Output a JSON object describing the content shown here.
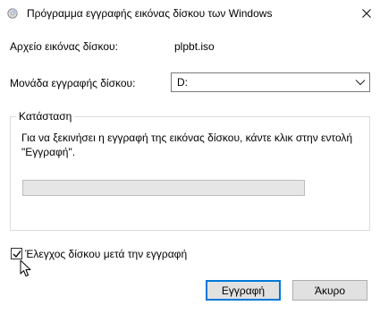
{
  "window": {
    "title": "Πρόγραμμα εγγραφής εικόνας δίσκου των Windows",
    "icon": "disc-burner-icon",
    "close_icon": "close-icon"
  },
  "form": {
    "file_label": "Αρχείο εικόνας δίσκου:",
    "file_value": "plpbt.iso",
    "drive_label": "Μονάδα εγγραφής δίσκου:",
    "drive_value": "D:"
  },
  "status": {
    "group_label": "Κατάσταση",
    "text": "Για να ξεκινήσει η εγγραφή της εικόνας δίσκου, κάντε κλικ στην εντολή \"Εγγραφή\".",
    "progress_percent": 0
  },
  "verify": {
    "label": "Έλεγχος δίσκου μετά την εγγραφή",
    "checked": true
  },
  "buttons": {
    "burn": "Εγγραφή",
    "cancel": "Άκυρο"
  },
  "colors": {
    "accent": "#0078d7",
    "progress_fill": "#06b025"
  }
}
